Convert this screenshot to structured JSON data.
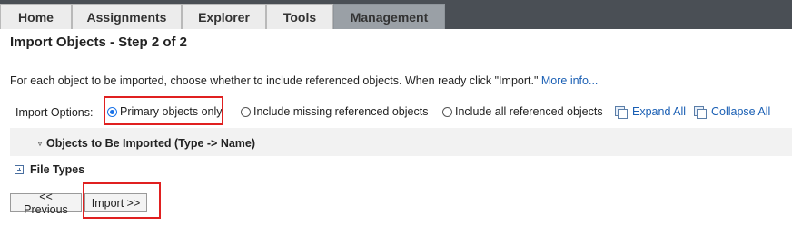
{
  "nav": {
    "tabs": [
      {
        "label": "Home"
      },
      {
        "label": "Assignments"
      },
      {
        "label": "Explorer"
      },
      {
        "label": "Tools"
      },
      {
        "label": "Management"
      }
    ],
    "active_tab": "Management"
  },
  "page": {
    "title": "Import Objects - Step 2 of 2",
    "instructions": "For each object to be imported, choose whether to include referenced objects. When ready click \"Import.\"",
    "more_info_link": "More info..."
  },
  "options": {
    "label": "Import Options:",
    "radios": [
      {
        "label": "Primary objects only",
        "checked": true
      },
      {
        "label": "Include missing referenced objects",
        "checked": false
      },
      {
        "label": "Include all referenced objects",
        "checked": false
      }
    ],
    "expand_all": "Expand All",
    "collapse_all": "Collapse All"
  },
  "tree": {
    "section_header": "Objects to Be Imported (Type -> Name)",
    "file_types": "File Types"
  },
  "buttons": {
    "previous": "<< Previous",
    "import": "Import >>"
  },
  "colors": {
    "nav_background": "#4a4f55",
    "active_tab": "#9aa0a6",
    "link": "#1a5fb4",
    "highlight": "#e02020"
  }
}
